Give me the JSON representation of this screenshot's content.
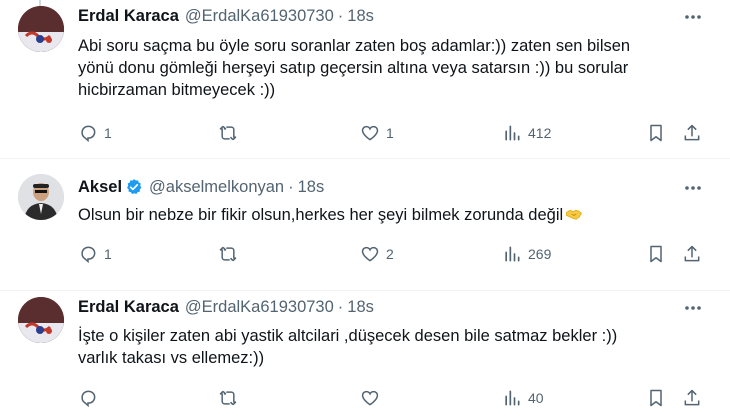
{
  "tweets": [
    {
      "name": "Erdal Karaca",
      "handle": "@ErdalKa61930730",
      "time": "18s",
      "lines": [
        "Abi soru saçma bu öyle soru soranlar zaten boş adamlar:)) zaten sen bilsen",
        "yönü donu gömleği herşeyi satıp geçersin altına veya satarsın :)) bu sorular",
        "hicbirzaman bitmeyecek :))"
      ],
      "replies": "1",
      "retweets": "",
      "likes": "1",
      "views": "412"
    },
    {
      "name": "Aksel",
      "handle": "@akselmelkonyan",
      "time": "18s",
      "verified": true,
      "lines": [
        "Olsun bir nebze bir fikir olsun,herkes her şeyi bilmek zorunda değil"
      ],
      "emoji": "handshake-emoji",
      "replies": "1",
      "retweets": "",
      "likes": "2",
      "views": "269"
    },
    {
      "name": "Erdal Karaca",
      "handle": "@ErdalKa61930730",
      "time": "18s",
      "lines": [
        "İşte o kişiler zaten abi yastik altcilari ,düşecek desen bile satmaz bekler :))",
        "varlık takası vs ellemez:))"
      ],
      "replies": "",
      "retweets": "",
      "likes": "",
      "views": "40"
    }
  ],
  "icons": {
    "reply": "reply-icon",
    "retweet": "retweet-icon",
    "like": "like-icon",
    "views": "views-icon",
    "bookmark": "bookmark-icon",
    "share": "share-icon",
    "more": "more-icon",
    "verified": "verified-badge-icon"
  },
  "colors": {
    "text": "#0f1419",
    "secondary": "#536471",
    "verified": "#1d9bf0",
    "divider": "#eff3f4"
  }
}
